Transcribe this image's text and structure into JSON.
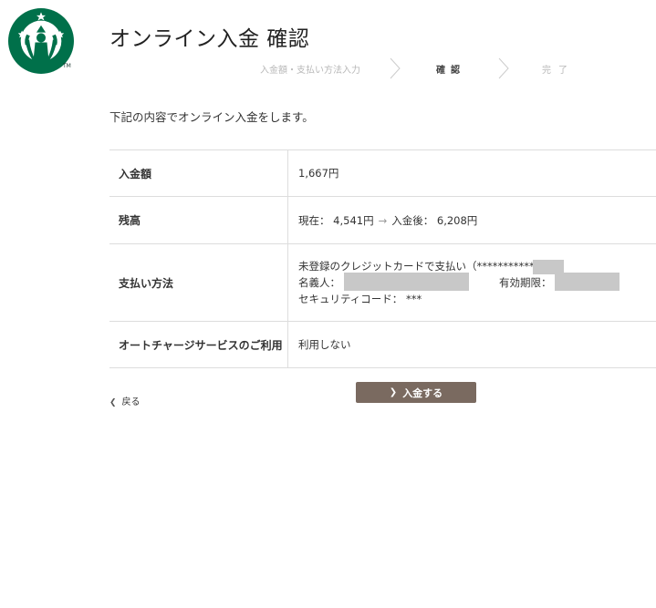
{
  "brand": {
    "tm": "TM",
    "color_green": "#00704a",
    "color_dark": "#1e3932"
  },
  "page": {
    "title": "オンライン入金 確認",
    "intro": "下記の内容でオンライン入金をします。"
  },
  "steps": [
    {
      "label": "入金額・支払い方法入力",
      "state": "done"
    },
    {
      "label": "確認",
      "state": "current"
    },
    {
      "label": "完了",
      "state": "upcoming"
    }
  ],
  "table": {
    "amount": {
      "label": "入金額",
      "value": "1,667円"
    },
    "balance": {
      "label": "残高",
      "current": "現在： 4,541円",
      "arrow": "→",
      "after": "入金後： 6,208円"
    },
    "payment": {
      "label": "支払い方法",
      "method": "未登録のクレジットカードで支払い（***********",
      "holder_label": "名義人：",
      "expiry_label": "有効期限：",
      "security": "セキュリティコード： ***"
    },
    "autocharge": {
      "label": "オートチャージサービスのご利用",
      "value": "利用しない"
    }
  },
  "actions": {
    "back": "戻る",
    "submit": "入金する",
    "button_color": "#7a6a60"
  }
}
